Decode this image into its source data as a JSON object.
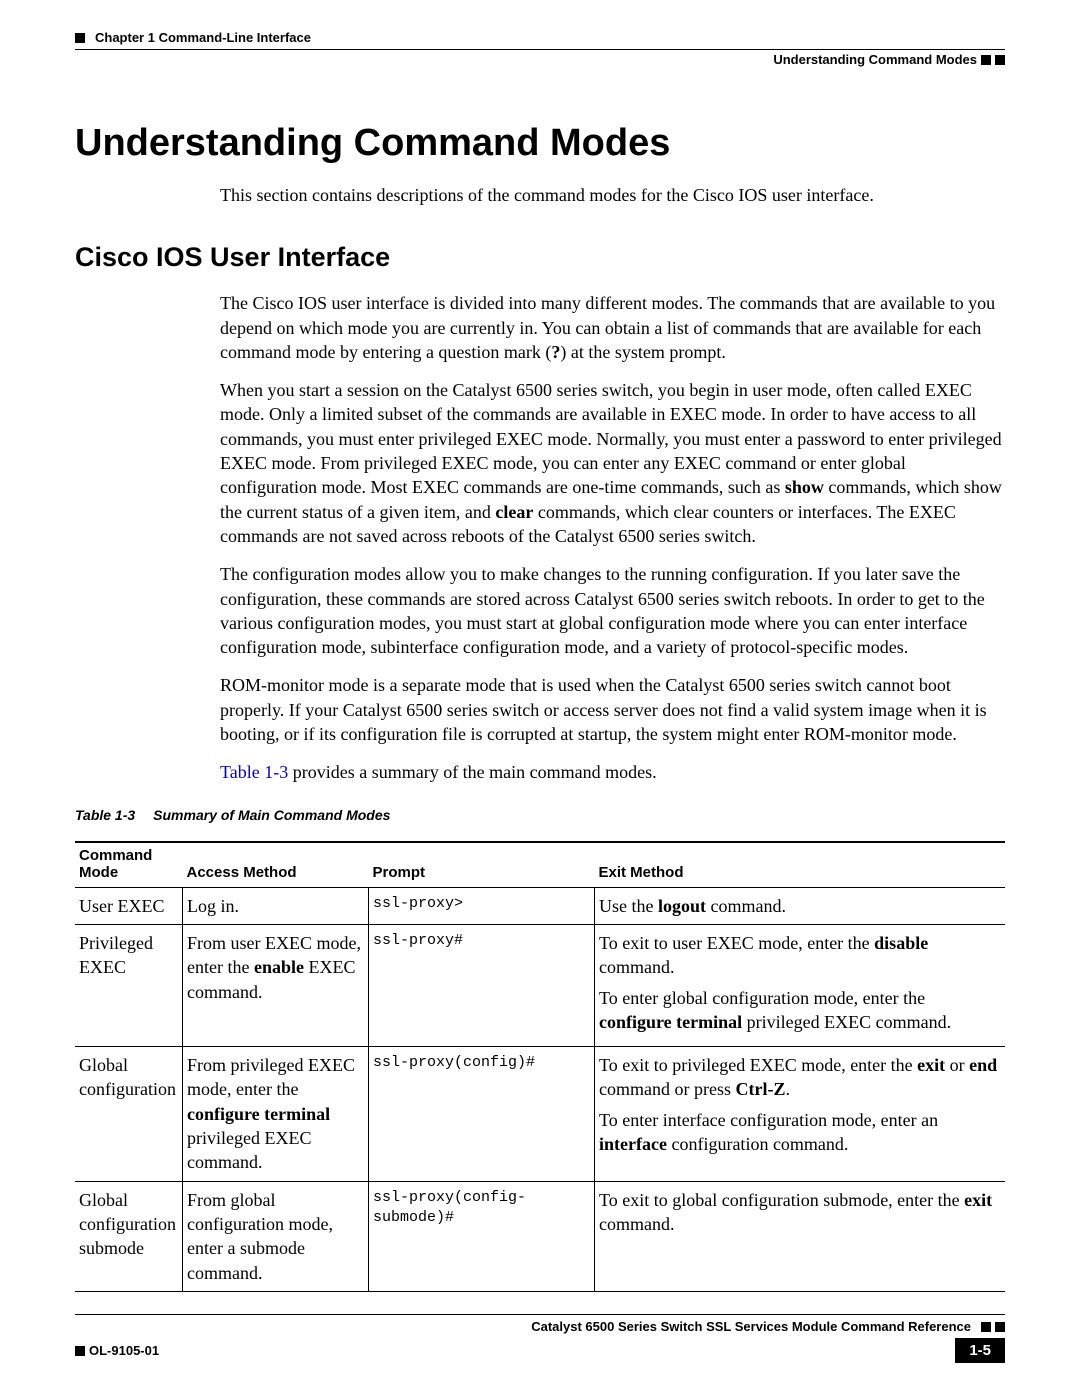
{
  "header": {
    "chapter": "Chapter 1      Command-Line Interface",
    "section": "Understanding Command Modes"
  },
  "h1": "Understanding Command Modes",
  "intro": "This section contains descriptions of the command modes for the Cisco IOS user interface.",
  "h2": "Cisco IOS User Interface",
  "p1_a": "The Cisco IOS user interface is divided into many different modes. The commands that are available to you depend on which mode you are currently in. You can obtain a list of commands that are available for each command mode by entering a question mark (",
  "p1_q": "?",
  "p1_b": ") at the system prompt.",
  "p2_a": "When you start a session on the Catalyst 6500 series switch, you begin in user mode, often called EXEC mode. Only a limited subset of the commands are available in EXEC mode. In order to have access to all commands, you must enter privileged EXEC mode. Normally, you must enter a password to enter privileged EXEC mode. From privileged EXEC mode, you can enter any EXEC command or enter global configuration mode. Most EXEC commands are one-time commands, such as ",
  "p2_show": "show",
  "p2_b": " commands, which show the current status of a given item, and ",
  "p2_clear": "clear",
  "p2_c": " commands, which clear counters or interfaces. The EXEC commands are not saved across reboots of the Catalyst 6500 series switch.",
  "p3": "The configuration modes allow you to make changes to the running configuration. If you later save the configuration, these commands are stored across Catalyst 6500 series switch reboots. In order to get to the various configuration modes, you must start at global configuration mode where you can enter interface configuration mode, subinterface configuration mode, and a variety of protocol-specific modes.",
  "p4": "ROM-monitor mode is a separate mode that is used when the Catalyst 6500 series switch cannot boot properly. If your Catalyst 6500 series switch or access server does not find a valid system image when it is booting, or if its configuration file is corrupted at startup, the system might enter ROM-monitor mode.",
  "p5_link": "Table 1-3",
  "p5_rest": " provides a summary of the main command modes.",
  "table_caption_num": "Table 1-3",
  "table_caption_title": "Summary of Main Command Modes",
  "th": {
    "mode": "Command Mode",
    "access": "Access Method",
    "prompt": "Prompt",
    "exit": "Exit Method"
  },
  "rows": [
    {
      "mode": "User EXEC",
      "access_a": "Log in.",
      "prompt": "ssl-proxy>",
      "exit_a1": "Use the ",
      "exit_b1": "logout",
      "exit_c1": " command."
    },
    {
      "mode": "Privileged EXEC",
      "access_a": "From user EXEC mode, enter the ",
      "access_b": "enable",
      "access_c": " EXEC command.",
      "prompt": "ssl-proxy#",
      "exit_a1": "To exit to user EXEC mode, enter the ",
      "exit_b1": "disable",
      "exit_c1": " command.",
      "exit_a2": "To enter global configuration mode, enter the ",
      "exit_b2": "configure terminal",
      "exit_c2": " privileged EXEC command."
    },
    {
      "mode": "Global configuration",
      "access_a": "From privileged EXEC mode, enter the ",
      "access_b": "configure terminal",
      "access_c": " privileged EXEC command.",
      "prompt": "ssl-proxy(config)#",
      "exit_a1": "To exit to privileged EXEC mode, enter the ",
      "exit_b1": "exit",
      "exit_c1": " or ",
      "exit_d1": "end",
      "exit_e1": " command or press ",
      "exit_f1": "Ctrl-Z",
      "exit_g1": ".",
      "exit_a2": "To enter interface configuration mode, enter an ",
      "exit_b2": "interface",
      "exit_c2": " configuration command."
    },
    {
      "mode": "Global configuration submode",
      "access_a": "From global configuration mode, enter a submode command.",
      "prompt": "ssl-proxy(config-submode)#",
      "exit_a1": "To exit to global configuration submode, enter the ",
      "exit_b1": "exit",
      "exit_c1": " command."
    }
  ],
  "footer": {
    "title": "Catalyst 6500 Series Switch SSL Services Module Command Reference",
    "doc_id": "OL-9105-01",
    "page": "1-5"
  }
}
